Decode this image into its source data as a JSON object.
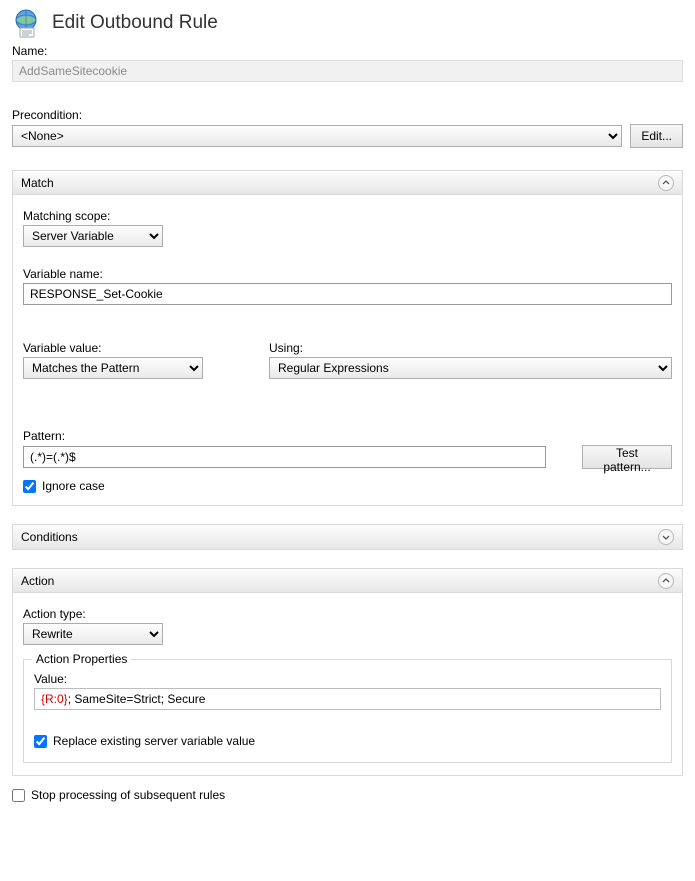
{
  "header": {
    "title": "Edit Outbound Rule"
  },
  "name": {
    "label": "Name:",
    "value": "AddSameSitecookie"
  },
  "precondition": {
    "label": "Precondition:",
    "value": "<None>",
    "edit_btn": "Edit..."
  },
  "match": {
    "title": "Match",
    "scope_label": "Matching scope:",
    "scope_value": "Server Variable",
    "var_name_label": "Variable name:",
    "var_name_value": "RESPONSE_Set-Cookie",
    "var_value_label": "Variable value:",
    "var_value_value": "Matches the Pattern",
    "using_label": "Using:",
    "using_value": "Regular Expressions",
    "pattern_label": "Pattern:",
    "pattern_value": "(.*)=(.*)$",
    "test_btn": "Test pattern...",
    "ignore_case": "Ignore case"
  },
  "conditions": {
    "title": "Conditions"
  },
  "action": {
    "title": "Action",
    "type_label": "Action type:",
    "type_value": "Rewrite",
    "props_title": "Action Properties",
    "value_label": "Value:",
    "value_hl": "{R:0}",
    "value_rest": "; SameSite=Strict; Secure",
    "replace": "Replace existing server variable value"
  },
  "stop": {
    "label": "Stop processing of subsequent rules"
  }
}
